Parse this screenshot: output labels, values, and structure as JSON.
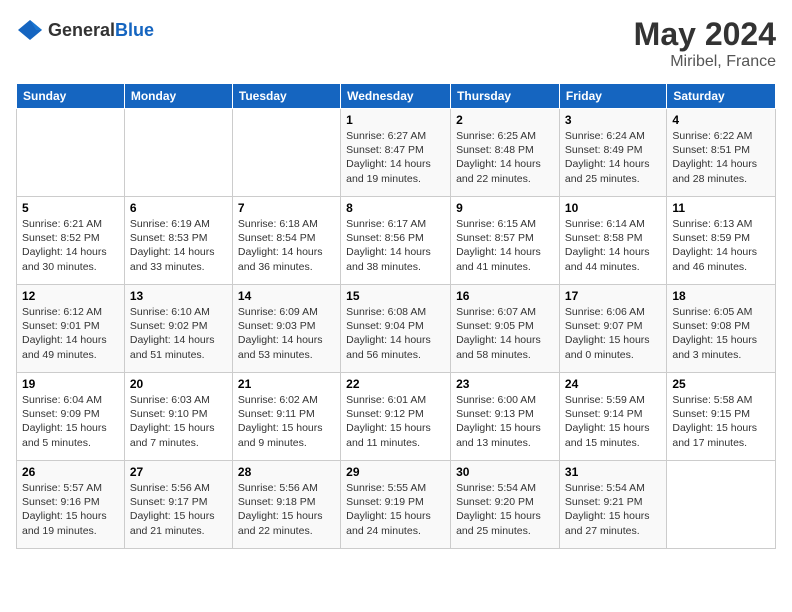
{
  "header": {
    "logo_general": "General",
    "logo_blue": "Blue",
    "month_year": "May 2024",
    "location": "Miribel, France"
  },
  "days_of_week": [
    "Sunday",
    "Monday",
    "Tuesday",
    "Wednesday",
    "Thursday",
    "Friday",
    "Saturday"
  ],
  "weeks": [
    [
      {
        "day": "",
        "content": ""
      },
      {
        "day": "",
        "content": ""
      },
      {
        "day": "",
        "content": ""
      },
      {
        "day": "1",
        "content": "Sunrise: 6:27 AM\nSunset: 8:47 PM\nDaylight: 14 hours\nand 19 minutes."
      },
      {
        "day": "2",
        "content": "Sunrise: 6:25 AM\nSunset: 8:48 PM\nDaylight: 14 hours\nand 22 minutes."
      },
      {
        "day": "3",
        "content": "Sunrise: 6:24 AM\nSunset: 8:49 PM\nDaylight: 14 hours\nand 25 minutes."
      },
      {
        "day": "4",
        "content": "Sunrise: 6:22 AM\nSunset: 8:51 PM\nDaylight: 14 hours\nand 28 minutes."
      }
    ],
    [
      {
        "day": "5",
        "content": "Sunrise: 6:21 AM\nSunset: 8:52 PM\nDaylight: 14 hours\nand 30 minutes."
      },
      {
        "day": "6",
        "content": "Sunrise: 6:19 AM\nSunset: 8:53 PM\nDaylight: 14 hours\nand 33 minutes."
      },
      {
        "day": "7",
        "content": "Sunrise: 6:18 AM\nSunset: 8:54 PM\nDaylight: 14 hours\nand 36 minutes."
      },
      {
        "day": "8",
        "content": "Sunrise: 6:17 AM\nSunset: 8:56 PM\nDaylight: 14 hours\nand 38 minutes."
      },
      {
        "day": "9",
        "content": "Sunrise: 6:15 AM\nSunset: 8:57 PM\nDaylight: 14 hours\nand 41 minutes."
      },
      {
        "day": "10",
        "content": "Sunrise: 6:14 AM\nSunset: 8:58 PM\nDaylight: 14 hours\nand 44 minutes."
      },
      {
        "day": "11",
        "content": "Sunrise: 6:13 AM\nSunset: 8:59 PM\nDaylight: 14 hours\nand 46 minutes."
      }
    ],
    [
      {
        "day": "12",
        "content": "Sunrise: 6:12 AM\nSunset: 9:01 PM\nDaylight: 14 hours\nand 49 minutes."
      },
      {
        "day": "13",
        "content": "Sunrise: 6:10 AM\nSunset: 9:02 PM\nDaylight: 14 hours\nand 51 minutes."
      },
      {
        "day": "14",
        "content": "Sunrise: 6:09 AM\nSunset: 9:03 PM\nDaylight: 14 hours\nand 53 minutes."
      },
      {
        "day": "15",
        "content": "Sunrise: 6:08 AM\nSunset: 9:04 PM\nDaylight: 14 hours\nand 56 minutes."
      },
      {
        "day": "16",
        "content": "Sunrise: 6:07 AM\nSunset: 9:05 PM\nDaylight: 14 hours\nand 58 minutes."
      },
      {
        "day": "17",
        "content": "Sunrise: 6:06 AM\nSunset: 9:07 PM\nDaylight: 15 hours\nand 0 minutes."
      },
      {
        "day": "18",
        "content": "Sunrise: 6:05 AM\nSunset: 9:08 PM\nDaylight: 15 hours\nand 3 minutes."
      }
    ],
    [
      {
        "day": "19",
        "content": "Sunrise: 6:04 AM\nSunset: 9:09 PM\nDaylight: 15 hours\nand 5 minutes."
      },
      {
        "day": "20",
        "content": "Sunrise: 6:03 AM\nSunset: 9:10 PM\nDaylight: 15 hours\nand 7 minutes."
      },
      {
        "day": "21",
        "content": "Sunrise: 6:02 AM\nSunset: 9:11 PM\nDaylight: 15 hours\nand 9 minutes."
      },
      {
        "day": "22",
        "content": "Sunrise: 6:01 AM\nSunset: 9:12 PM\nDaylight: 15 hours\nand 11 minutes."
      },
      {
        "day": "23",
        "content": "Sunrise: 6:00 AM\nSunset: 9:13 PM\nDaylight: 15 hours\nand 13 minutes."
      },
      {
        "day": "24",
        "content": "Sunrise: 5:59 AM\nSunset: 9:14 PM\nDaylight: 15 hours\nand 15 minutes."
      },
      {
        "day": "25",
        "content": "Sunrise: 5:58 AM\nSunset: 9:15 PM\nDaylight: 15 hours\nand 17 minutes."
      }
    ],
    [
      {
        "day": "26",
        "content": "Sunrise: 5:57 AM\nSunset: 9:16 PM\nDaylight: 15 hours\nand 19 minutes."
      },
      {
        "day": "27",
        "content": "Sunrise: 5:56 AM\nSunset: 9:17 PM\nDaylight: 15 hours\nand 21 minutes."
      },
      {
        "day": "28",
        "content": "Sunrise: 5:56 AM\nSunset: 9:18 PM\nDaylight: 15 hours\nand 22 minutes."
      },
      {
        "day": "29",
        "content": "Sunrise: 5:55 AM\nSunset: 9:19 PM\nDaylight: 15 hours\nand 24 minutes."
      },
      {
        "day": "30",
        "content": "Sunrise: 5:54 AM\nSunset: 9:20 PM\nDaylight: 15 hours\nand 25 minutes."
      },
      {
        "day": "31",
        "content": "Sunrise: 5:54 AM\nSunset: 9:21 PM\nDaylight: 15 hours\nand 27 minutes."
      },
      {
        "day": "",
        "content": ""
      }
    ]
  ]
}
